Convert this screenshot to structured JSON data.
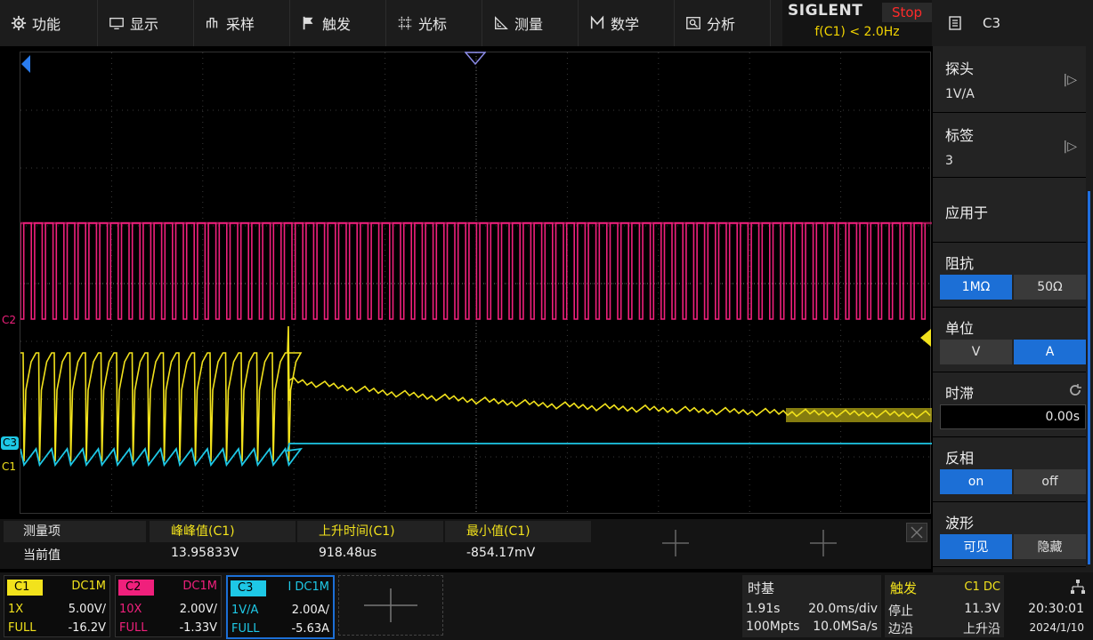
{
  "menu": [
    {
      "label": "功能",
      "icon": "gear-icon"
    },
    {
      "label": "显示",
      "icon": "monitor-icon"
    },
    {
      "label": "采样",
      "icon": "sample-icon"
    },
    {
      "label": "触发",
      "icon": "flag-icon"
    },
    {
      "label": "光标",
      "icon": "cursor-grid-icon"
    },
    {
      "label": "测量",
      "icon": "ruler-icon"
    },
    {
      "label": "数学",
      "icon": "math-icon"
    },
    {
      "label": "分析",
      "icon": "analysis-icon"
    }
  ],
  "brand": {
    "name": "SIGLENT",
    "status": "Stop",
    "trigger_freq": "f(C1) < 2.0Hz"
  },
  "channel_header": {
    "label": "C3",
    "icon": "document-icon"
  },
  "side_panel": {
    "probe": {
      "title": "探头",
      "value": "1V/A"
    },
    "label": {
      "title": "标签",
      "value": "3"
    },
    "apply_to": {
      "title": "应用于"
    },
    "impedance": {
      "title": "阻抗",
      "options": [
        "1MΩ",
        "50Ω"
      ],
      "selected": "1MΩ"
    },
    "unit": {
      "title": "单位",
      "options": [
        "V",
        "A"
      ],
      "selected": "A"
    },
    "delay": {
      "title": "时滞",
      "value": "0.00s"
    },
    "invert": {
      "title": "反相",
      "options": [
        "on",
        "off"
      ],
      "selected": "on"
    },
    "waveform": {
      "title": "波形",
      "options": [
        "可见",
        "隐藏"
      ],
      "selected": "可见"
    }
  },
  "markers": {
    "c2": "C2",
    "c3": "C3",
    "c1": "C1"
  },
  "measurements": {
    "row_labels": [
      "测量项",
      "当前值"
    ],
    "items": [
      {
        "name": "峰峰值(C1)",
        "value": "13.95833V"
      },
      {
        "name": "上升时间(C1)",
        "value": "918.48us"
      },
      {
        "name": "最小值(C1)",
        "value": "-854.17mV"
      }
    ]
  },
  "channels": [
    {
      "name": "C1",
      "coupling": "DC1M",
      "probe": "1X",
      "scale": "5.00V/",
      "bw": "FULL",
      "offset": "-16.2V",
      "color": "#f2e21c"
    },
    {
      "name": "C2",
      "coupling": "DC1M",
      "probe": "10X",
      "scale": "2.00V/",
      "bw": "FULL",
      "offset": "-1.33V",
      "color": "#f0207c"
    },
    {
      "name": "C3",
      "coupling": "I DC1M",
      "probe": "1V/A",
      "scale": "2.00A/",
      "bw": "FULL",
      "offset": "-5.63A",
      "color": "#1ec8e6"
    }
  ],
  "timebase": {
    "title": "时基",
    "delay": "1.91s",
    "scale": "20.0ms/div",
    "memory": "100Mpts",
    "sample_rate": "10.0MSa/s"
  },
  "trigger": {
    "title": "触发",
    "source": "C1 DC",
    "mode": "停止",
    "level": "11.3V",
    "type": "边沿",
    "slope": "上升沿"
  },
  "clock": {
    "time": "20:30:01",
    "date": "2024/1/10"
  }
}
